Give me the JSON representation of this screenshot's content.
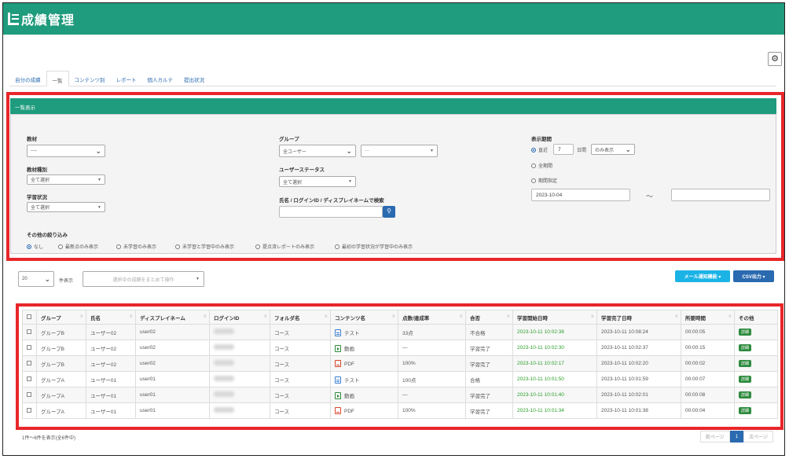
{
  "header": {
    "title": "成績管理",
    "logo_icon": "list-logo-icon"
  },
  "tabs": [
    {
      "label": "自分の成績"
    },
    {
      "label": "一覧"
    },
    {
      "label": "コンテンツ別"
    },
    {
      "label": "レポート"
    },
    {
      "label": "個人カルテ"
    },
    {
      "label": "提出状況"
    }
  ],
  "panel": {
    "title": "一覧表示",
    "material": {
      "label": "教材",
      "value": "----"
    },
    "material_type": {
      "label": "教材種別",
      "value": "全て選択"
    },
    "learning_status": {
      "label": "学習状況",
      "value": "全て選択"
    },
    "group": {
      "label": "グループ",
      "value": "全ユーザー",
      "sub_value": "---"
    },
    "user_status": {
      "label": "ユーザーステータス",
      "value": "全て選択"
    },
    "name_search": {
      "label": "氏名 / ログインID / ディスプレイネームで検索",
      "value": ""
    },
    "display_period": {
      "label": "表示期間",
      "recent_label": "直近",
      "recent_days": "7",
      "days_unit": "日間",
      "mode_value": "のみ表示",
      "all_label": "全期間",
      "range_label": "期間指定",
      "date_from": "2023-10-04",
      "range_sep": "〜",
      "date_to": ""
    },
    "other_filter": {
      "label": "その他の絞り込み",
      "options": [
        "なし",
        "最新点のみ表示",
        "未学習のみ表示",
        "未学習と学習中のみ表示",
        "提点済レポートのみ表示",
        "最初の学習状況が学習中のみ表示"
      ]
    }
  },
  "toolbar": {
    "page_size": "20",
    "page_size_suffix": "件表示",
    "bulk_action": "選択中の成績をまとめて操作",
    "mail_button": "メール通知機能 ▾",
    "csv_button": "CSV出力 ▾"
  },
  "table": {
    "headers": [
      "グループ",
      "氏名",
      "ディスプレイネーム",
      "ログインID",
      "フォルダ名",
      "コンテンツ名",
      "点数/達成率",
      "合否",
      "学習開始日時",
      "学習完了日時",
      "所要時間",
      "その他"
    ],
    "rows": [
      {
        "group": "グループB",
        "name": "ユーザー02",
        "display": "user02",
        "folder": "コース",
        "icon": "document-icon",
        "content": "テスト",
        "score": "33点",
        "result": "不合格",
        "start": "2023-10-11 10:02:38",
        "end": "2023-10-11 10:08:24",
        "duration": "00:00:05",
        "action": "詳細"
      },
      {
        "group": "グループB",
        "name": "ユーザー02",
        "display": "user02",
        "folder": "コース",
        "icon": "video-icon",
        "content": "動画",
        "score": "—",
        "result": "学習完了",
        "start": "2023-10-11 10:02:30",
        "end": "2023-10-11 10:02:37",
        "duration": "00:00:15",
        "action": "詳細"
      },
      {
        "group": "グループB",
        "name": "ユーザー02",
        "display": "user02",
        "folder": "コース",
        "icon": "pdf-icon",
        "content": "PDF",
        "score": "100%",
        "result": "学習完了",
        "start": "2023-10-11 10:02:17",
        "end": "2023-10-11 10:02:20",
        "duration": "00:00:02",
        "action": "詳細"
      },
      {
        "group": "グループA",
        "name": "ユーザー01",
        "display": "user01",
        "folder": "コース",
        "icon": "document-icon",
        "content": "テスト",
        "score": "100点",
        "result": "合格",
        "start": "2023-10-11 10:01:50",
        "end": "2023-10-11 10:01:59",
        "duration": "00:00:07",
        "action": "詳細"
      },
      {
        "group": "グループA",
        "name": "ユーザー01",
        "display": "user01",
        "folder": "コース",
        "icon": "video-icon",
        "content": "動画",
        "score": "—",
        "result": "学習完了",
        "start": "2023-10-11 10:01:40",
        "end": "2023-10-11 10:02:01",
        "duration": "00:00:08",
        "action": "詳細"
      },
      {
        "group": "グループA",
        "name": "ユーザー01",
        "display": "user01",
        "folder": "コース",
        "icon": "pdf-icon",
        "content": "PDF",
        "score": "100%",
        "result": "学習完了",
        "start": "2023-10-11 10:01:34",
        "end": "2023-10-11 10:01:38",
        "duration": "00:00:04",
        "action": "詳細"
      }
    ]
  },
  "footer": {
    "info": "1件～6件を表示(全6件中)",
    "prev": "前ページ",
    "current_page": "1",
    "next": "次ページ"
  },
  "colors": {
    "brand": "#1f9b7d",
    "highlight": "#e8262a",
    "primary": "#2a6ab0",
    "info": "#1bb3e6"
  }
}
